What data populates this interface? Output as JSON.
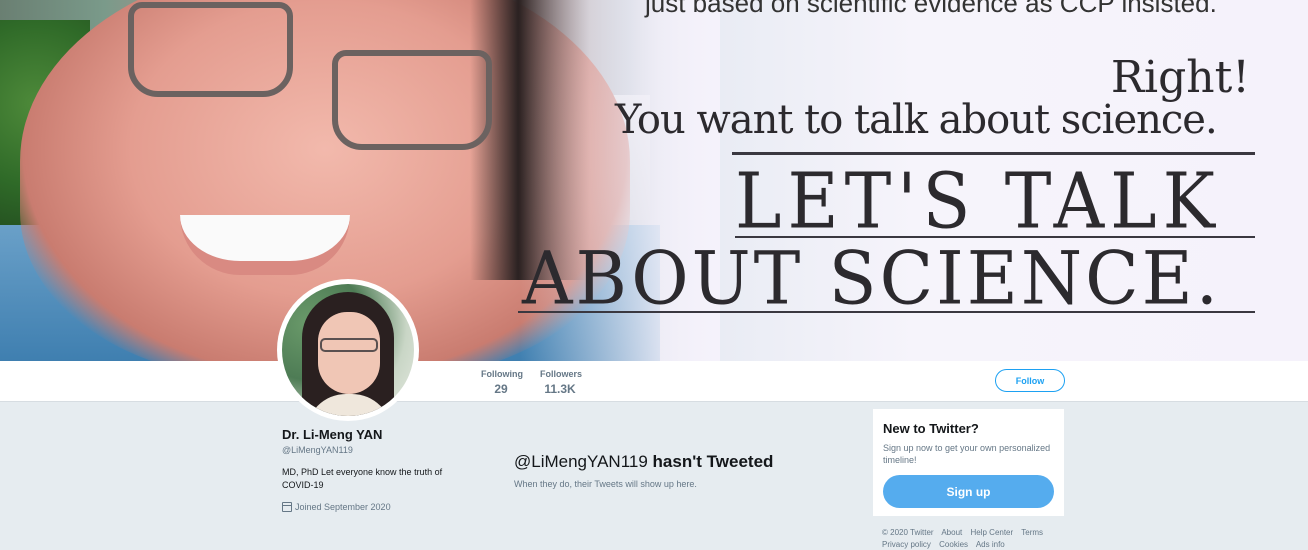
{
  "banner": {
    "line_top": "just based on scientific evidence as CCP insisted.",
    "line_right": "Right!",
    "line_talk": "You want to talk about science.",
    "line_lets": "LET'S TALK",
    "line_about": "ABOUT SCIENCE."
  },
  "nav": {
    "following_label": "Following",
    "following_value": "29",
    "followers_label": "Followers",
    "followers_value": "11.3K",
    "follow_button": "Follow"
  },
  "profile": {
    "name": "Dr. Li-Meng YAN",
    "handle": "@LiMengYAN119",
    "bio": "MD, PhD Let everyone know the truth of COVID-19",
    "joined": "Joined September 2020"
  },
  "timeline": {
    "empty_handle": "@LiMengYAN119",
    "empty_suffix": "hasn't Tweeted",
    "empty_sub": "When they do, their Tweets will show up here."
  },
  "signup": {
    "title": "New to Twitter?",
    "desc": "Sign up now to get your own personalized timeline!",
    "button": "Sign up"
  },
  "footer": {
    "links": [
      "© 2020 Twitter",
      "About",
      "Help Center",
      "Terms",
      "Privacy policy",
      "Cookies",
      "Ads info"
    ]
  },
  "colors": {
    "accent": "#1da1f2",
    "signup_button": "#55acee",
    "page_bg": "#e6ecf0"
  }
}
